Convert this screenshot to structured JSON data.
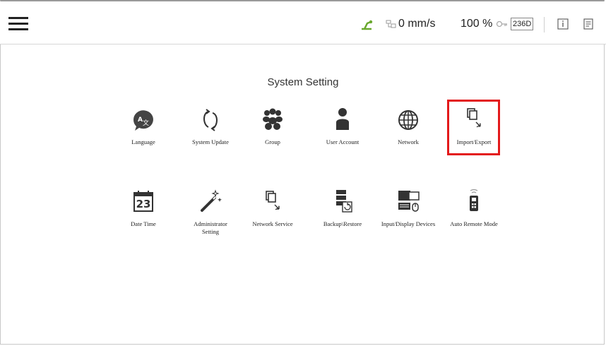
{
  "status": {
    "speed": "0 mm/s",
    "percent": "100 %",
    "code": "236D"
  },
  "page_title": "System Setting",
  "tiles_row1": [
    {
      "label": "Language",
      "icon": "language-icon"
    },
    {
      "label": "System Update",
      "icon": "system-update-icon"
    },
    {
      "label": "Group",
      "icon": "group-icon"
    },
    {
      "label": "User Account",
      "icon": "user-account-icon"
    },
    {
      "label": "Network",
      "icon": "network-globe-icon"
    },
    {
      "label": "Import/Export",
      "icon": "import-export-icon"
    }
  ],
  "tiles_row2": [
    {
      "label": "Date Time",
      "icon": "calendar-icon",
      "icon_text": "23"
    },
    {
      "label": "Administrator Setting",
      "icon": "magic-wand-icon"
    },
    {
      "label": "Network Service",
      "icon": "network-service-icon"
    },
    {
      "label": "Backup\\Restore",
      "icon": "backup-restore-icon"
    },
    {
      "label": "Input/Display Devices",
      "icon": "input-display-devices-icon"
    },
    {
      "label": "Auto Remote Mode",
      "icon": "auto-remote-mode-icon"
    }
  ],
  "colors": {
    "highlight": "#e3191b",
    "robot_status": "#6aa82e"
  }
}
